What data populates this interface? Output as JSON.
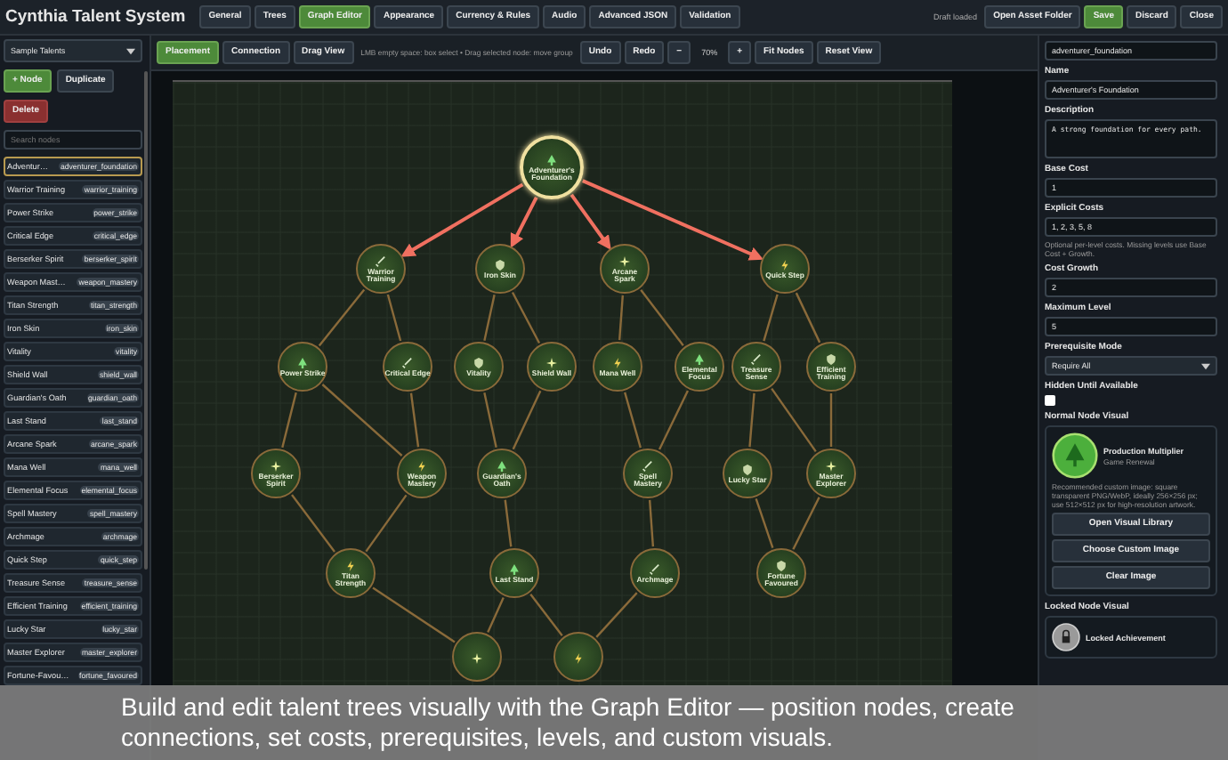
{
  "app_title": "Cynthia Talent System",
  "tabs": [
    {
      "label": "General",
      "selected": false
    },
    {
      "label": "Trees",
      "selected": false
    },
    {
      "label": "Graph Editor",
      "selected": true
    },
    {
      "label": "Appearance",
      "selected": false
    },
    {
      "label": "Currency & Rules",
      "selected": false
    },
    {
      "label": "Audio",
      "selected": false
    },
    {
      "label": "Advanced JSON",
      "selected": false
    },
    {
      "label": "Validation",
      "selected": false
    }
  ],
  "status": "Draft loaded",
  "actions": [
    {
      "label": "Open Asset Folder",
      "kind": "plain"
    },
    {
      "label": "Save",
      "kind": "primary"
    },
    {
      "label": "Discard",
      "kind": "plain"
    },
    {
      "label": "Close",
      "kind": "plain"
    }
  ],
  "sidebar": {
    "tree_select": "Sample Talents",
    "add_button": "+ Node",
    "duplicate_button": "Duplicate",
    "delete_button": "Delete",
    "search_placeholder": "Search nodes",
    "items": [
      {
        "name": "Adventur…",
        "id": "adventurer_foundation",
        "selected": true
      },
      {
        "name": "Warrior Training",
        "id": "warrior_training",
        "selected": false
      },
      {
        "name": "Power Strike",
        "id": "power_strike",
        "selected": false
      },
      {
        "name": "Critical Edge",
        "id": "critical_edge",
        "selected": false
      },
      {
        "name": "Berserker Spirit",
        "id": "berserker_spirit",
        "selected": false
      },
      {
        "name": "Weapon Mast…",
        "id": "weapon_mastery",
        "selected": false
      },
      {
        "name": "Titan Strength",
        "id": "titan_strength",
        "selected": false
      },
      {
        "name": "Iron Skin",
        "id": "iron_skin",
        "selected": false
      },
      {
        "name": "Vitality",
        "id": "vitality",
        "selected": false
      },
      {
        "name": "Shield Wall",
        "id": "shield_wall",
        "selected": false
      },
      {
        "name": "Guardian's Oath",
        "id": "guardian_oath",
        "selected": false
      },
      {
        "name": "Last Stand",
        "id": "last_stand",
        "selected": false
      },
      {
        "name": "Arcane Spark",
        "id": "arcane_spark",
        "selected": false
      },
      {
        "name": "Mana Well",
        "id": "mana_well",
        "selected": false
      },
      {
        "name": "Elemental Focus",
        "id": "elemental_focus",
        "selected": false
      },
      {
        "name": "Spell Mastery",
        "id": "spell_mastery",
        "selected": false
      },
      {
        "name": "Archmage",
        "id": "archmage",
        "selected": false
      },
      {
        "name": "Quick Step",
        "id": "quick_step",
        "selected": false
      },
      {
        "name": "Treasure Sense",
        "id": "treasure_sense",
        "selected": false
      },
      {
        "name": "Efficient Training",
        "id": "efficient_training",
        "selected": false
      },
      {
        "name": "Lucky Star",
        "id": "lucky_star",
        "selected": false
      },
      {
        "name": "Master Explorer",
        "id": "master_explorer",
        "selected": false
      },
      {
        "name": "Fortune-Favou…",
        "id": "fortune_favoured",
        "selected": false
      }
    ]
  },
  "toolbar": {
    "modes": [
      {
        "label": "Placement",
        "selected": true
      },
      {
        "label": "Connection",
        "selected": false
      },
      {
        "label": "Drag View",
        "selected": false
      }
    ],
    "hint": "LMB empty space: box select • Drag selected node: move group",
    "undo": "Undo",
    "redo": "Redo",
    "zoom_out": "−",
    "zoom": "70%",
    "zoom_in": "+",
    "fit": "Fit Nodes",
    "reset": "Reset View"
  },
  "graph": {
    "nodes": [
      {
        "label": "Adventurer's Foundation",
        "selected": true
      },
      {
        "label": "Warrior Training",
        "selected": false
      },
      {
        "label": "Iron Skin",
        "selected": false
      },
      {
        "label": "Arcane Spark",
        "selected": false
      },
      {
        "label": "Quick Step",
        "selected": false
      },
      {
        "label": "Power Strike",
        "selected": false
      },
      {
        "label": "Critical Edge",
        "selected": false
      },
      {
        "label": "Vitality",
        "selected": false
      },
      {
        "label": "Shield Wall",
        "selected": false
      },
      {
        "label": "Mana Well",
        "selected": false
      },
      {
        "label": "Elemental Focus",
        "selected": false
      },
      {
        "label": "Treasure Sense",
        "selected": false
      },
      {
        "label": "Efficient Training",
        "selected": false
      },
      {
        "label": "Berserker Spirit",
        "selected": false
      },
      {
        "label": "Weapon Mastery",
        "selected": false
      },
      {
        "label": "Guardian's Oath",
        "selected": false
      },
      {
        "label": "Spell Mastery",
        "selected": false
      },
      {
        "label": "Lucky Star",
        "selected": false
      },
      {
        "label": "Master Explorer",
        "selected": false
      },
      {
        "label": "Titan Strength",
        "selected": false
      },
      {
        "label": "Last Stand",
        "selected": false
      },
      {
        "label": "Archmage",
        "selected": false
      },
      {
        "label": "Fortune Favoured",
        "selected": false
      },
      {
        "selected": false
      },
      {
        "selected": false
      }
    ]
  },
  "inspector": {
    "node_id": "adventurer_foundation",
    "name_label": "Name",
    "name": "Adventurer's Foundation",
    "description_label": "Description",
    "description": "A strong foundation for every path.",
    "base_cost_label": "Base Cost",
    "base_cost": "1",
    "explicit_costs_label": "Explicit Costs",
    "explicit_costs": "1, 2, 3, 5, 8",
    "explicit_costs_help": "Optional per-level costs. Missing levels use Base Cost + Growth.",
    "cost_growth_label": "Cost Growth",
    "cost_growth": "2",
    "max_level_label": "Maximum Level",
    "max_level": "5",
    "prereq_label": "Prerequisite Mode",
    "prereq": "Require All",
    "hidden_label": "Hidden Until Available",
    "hidden": false,
    "normal_visual_label": "Normal Node Visual",
    "normal_visual": {
      "title": "Production Multiplier",
      "subtitle": "Game Renewal",
      "help": "Recommended custom image: square transparent PNG/WebP, ideally 256×256 px; use 512×512 px for high-resolution artwork.",
      "buttons": [
        "Open Visual Library",
        "Choose Custom Image",
        "Clear Image"
      ]
    },
    "locked_visual_label": "Locked Node Visual",
    "locked_visual": {
      "title": "Locked Achievement"
    }
  },
  "caption": "Build and edit talent trees visually with the Graph Editor — position nodes, create connections, set costs, prerequisites, levels, and custom visuals."
}
